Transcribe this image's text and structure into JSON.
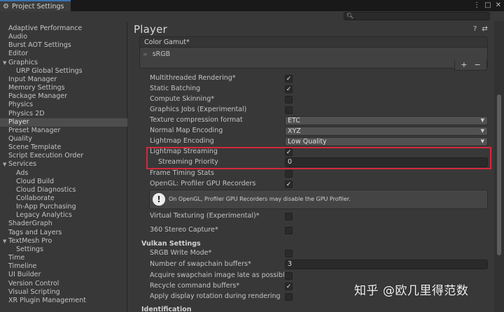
{
  "window": {
    "tab_title": "Project Settings",
    "controls": [
      "⋮",
      "□",
      "✕"
    ]
  },
  "search": {
    "value": "",
    "icon": "search-icon"
  },
  "sidebar": {
    "items": [
      {
        "label": "Adaptive Performance",
        "level": 0,
        "expandable": false
      },
      {
        "label": "Audio",
        "level": 0,
        "expandable": false
      },
      {
        "label": "Burst AOT Settings",
        "level": 0,
        "expandable": false
      },
      {
        "label": "Editor",
        "level": 0,
        "expandable": false
      },
      {
        "label": "Graphics",
        "level": 0,
        "expandable": true
      },
      {
        "label": "URP Global Settings",
        "level": 1,
        "expandable": false
      },
      {
        "label": "Input Manager",
        "level": 0,
        "expandable": false
      },
      {
        "label": "Memory Settings",
        "level": 0,
        "expandable": false
      },
      {
        "label": "Package Manager",
        "level": 0,
        "expandable": false
      },
      {
        "label": "Physics",
        "level": 0,
        "expandable": false
      },
      {
        "label": "Physics 2D",
        "level": 0,
        "expandable": false
      },
      {
        "label": "Player",
        "level": 0,
        "expandable": false,
        "selected": true
      },
      {
        "label": "Preset Manager",
        "level": 0,
        "expandable": false
      },
      {
        "label": "Quality",
        "level": 0,
        "expandable": false
      },
      {
        "label": "Scene Template",
        "level": 0,
        "expandable": false
      },
      {
        "label": "Script Execution Order",
        "level": 0,
        "expandable": false
      },
      {
        "label": "Services",
        "level": 0,
        "expandable": true
      },
      {
        "label": "Ads",
        "level": 1,
        "expandable": false
      },
      {
        "label": "Cloud Build",
        "level": 1,
        "expandable": false
      },
      {
        "label": "Cloud Diagnostics",
        "level": 1,
        "expandable": false
      },
      {
        "label": "Collaborate",
        "level": 1,
        "expandable": false
      },
      {
        "label": "In-App Purchasing",
        "level": 1,
        "expandable": false
      },
      {
        "label": "Legacy Analytics",
        "level": 1,
        "expandable": false
      },
      {
        "label": "ShaderGraph",
        "level": 0,
        "expandable": false
      },
      {
        "label": "Tags and Layers",
        "level": 0,
        "expandable": false
      },
      {
        "label": "TextMesh Pro",
        "level": 0,
        "expandable": true
      },
      {
        "label": "Settings",
        "level": 1,
        "expandable": false
      },
      {
        "label": "Time",
        "level": 0,
        "expandable": false
      },
      {
        "label": "Timeline",
        "level": 0,
        "expandable": false
      },
      {
        "label": "UI Builder",
        "level": 0,
        "expandable": false
      },
      {
        "label": "Version Control",
        "level": 0,
        "expandable": false
      },
      {
        "label": "Visual Scripting",
        "level": 0,
        "expandable": false
      },
      {
        "label": "XR Plugin Management",
        "level": 0,
        "expandable": false
      }
    ]
  },
  "main": {
    "title": "Player",
    "header_icons": [
      "help-icon",
      "presets-icon",
      "more-icon"
    ],
    "color_gamut": {
      "header": "Color Gamut*",
      "items": [
        "sRGB"
      ],
      "add_label": "+",
      "remove_label": "−"
    },
    "settings": [
      {
        "label": "Multithreaded Rendering*",
        "type": "checkbox",
        "checked": true
      },
      {
        "label": "Static Batching",
        "type": "checkbox",
        "checked": true
      },
      {
        "label": "Compute Skinning*",
        "type": "checkbox",
        "checked": false
      },
      {
        "label": "Graphics Jobs (Experimental)",
        "type": "checkbox",
        "checked": false
      },
      {
        "label": "Texture compression format",
        "type": "dropdown",
        "value": "ETC"
      },
      {
        "label": "Normal Map Encoding",
        "type": "dropdown",
        "value": "XYZ"
      },
      {
        "label": "Lightmap Encoding",
        "type": "dropdown",
        "value": "Low Quality"
      },
      {
        "label": "Lightmap Streaming",
        "type": "checkbox",
        "checked": true
      },
      {
        "label": "Streaming Priority",
        "type": "field",
        "value": "0"
      },
      {
        "label": "Frame Timing Stats",
        "type": "checkbox",
        "checked": false
      },
      {
        "label": "OpenGL: Profiler GPU Recorders",
        "type": "checkbox",
        "checked": true
      }
    ],
    "info_message": "On OpenGL, Profiler GPU Recorders may disable the GPU Profiler.",
    "settings2": [
      {
        "label": "Virtual Texturing (Experimental)*",
        "type": "checkbox",
        "checked": false
      },
      {
        "label": "360 Stereo Capture*",
        "type": "checkbox",
        "checked": false
      }
    ],
    "vulkan": {
      "header": "Vulkan Settings",
      "settings": [
        {
          "label": "SRGB Write Mode*",
          "type": "checkbox",
          "checked": false
        },
        {
          "label": "Number of swapchain buffers*",
          "type": "field",
          "value": "3"
        },
        {
          "label": "Acquire swapchain image late as possible*",
          "type": "checkbox",
          "checked": false
        },
        {
          "label": "Recycle command buffers*",
          "type": "checkbox",
          "checked": true
        },
        {
          "label": "Apply display rotation during rendering",
          "type": "checkbox",
          "checked": false
        }
      ]
    },
    "identification_header": "Identification"
  },
  "watermark": "知乎 @欧几里得范数",
  "colors": {
    "highlight": "#d4283c",
    "selected_bg": "#4d4d4d",
    "panel_bg": "#383838"
  }
}
